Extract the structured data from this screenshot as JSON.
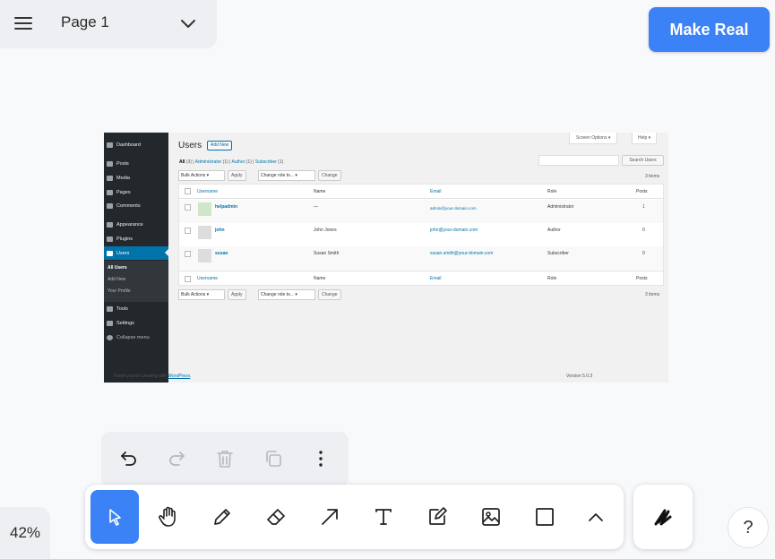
{
  "page_menu": {
    "page_name": "Page 1"
  },
  "make_real": {
    "label": "Make Real"
  },
  "zoom": {
    "level": "42%"
  },
  "help": {
    "label": "?"
  },
  "toolbar": {
    "tools": [
      "select-icon",
      "hand-icon",
      "pencil-icon",
      "eraser-icon",
      "arrow-icon",
      "text-icon",
      "note-icon",
      "image-icon",
      "rectangle-icon",
      "chevron-up-icon"
    ],
    "active_tool": "select-icon",
    "accent": "#3b82f6"
  },
  "actions": [
    "undo-icon",
    "redo-icon",
    "delete-icon",
    "duplicate-icon",
    "more-icon"
  ],
  "screenshot": {
    "sidebar": {
      "items": [
        "Dashboard",
        "Posts",
        "Media",
        "Pages",
        "Comments",
        "Appearance",
        "Plugins",
        "Users",
        "Tools",
        "Settings",
        "Collapse menu"
      ],
      "sub_items": [
        "All Users",
        "Add New",
        "Your Profile"
      ]
    },
    "title": "Users",
    "add_new": "Add New",
    "screen_options": "Screen Options ▾",
    "help": "Help ▾",
    "filters": {
      "all": "All",
      "all_count": "(3)",
      "administrator": "Administrator",
      "administrator_count": "(1)",
      "author": "Author",
      "author_count": "(1)",
      "subscriber": "Subscriber",
      "subscriber_count": "(1)",
      "sep": "|"
    },
    "search_button": "Search Users",
    "bulk_actions": "Bulk Actions",
    "apply": "Apply",
    "change_role": "Change role to...",
    "change": "Change",
    "items_count": "3 items",
    "columns": [
      "Username",
      "Name",
      "Email",
      "Role",
      "Posts"
    ],
    "rows": [
      {
        "username": "helpadmin",
        "name": "—",
        "email": "admin@your-domain.com",
        "role": "Administrator",
        "posts": "1"
      },
      {
        "username": "john",
        "name": "John Jones",
        "email": "john@your-domain.com",
        "role": "Author",
        "posts": "0"
      },
      {
        "username": "susan",
        "name": "Susan Smith",
        "email": "susan.smith@your-domain.com",
        "role": "Subscriber",
        "posts": "0"
      }
    ],
    "footer_text": "Thank you for creating with",
    "footer_link": "WordPress",
    "footer_period": ".",
    "version": "Version 5.0.3"
  }
}
